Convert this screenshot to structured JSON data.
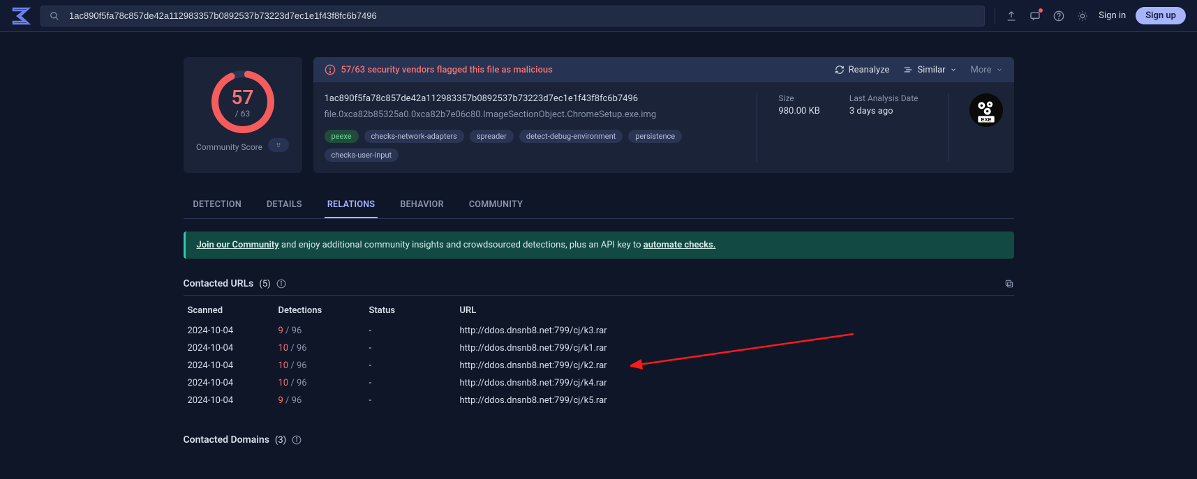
{
  "search": {
    "value": "1ac890f5fa78c857de42a112983357b0892537b73223d7ec1e1f43f8fc6b7496"
  },
  "auth": {
    "sign_in": "Sign in",
    "sign_up": "Sign up"
  },
  "score": {
    "value": "57",
    "total": "/ 63",
    "community_label": "Community Score"
  },
  "flag": {
    "message": "57/63 security vendors flagged this file as malicious"
  },
  "actions": {
    "reanalyze": "Reanalyze",
    "similar": "Similar",
    "more": "More"
  },
  "file": {
    "hash": "1ac890f5fa78c857de42a112983357b0892537b73223d7ec1e1f43f8fc6b7496",
    "name": "file.0xca82b85325a0.0xca82b7e06c80.ImageSectionObject.ChromeSetup.exe.img",
    "size_label": "Size",
    "size_value": "980.00 KB",
    "analysis_label": "Last Analysis Date",
    "analysis_value": "3 days ago",
    "type_label": "EXE"
  },
  "tags": [
    "peexe",
    "checks-network-adapters",
    "spreader",
    "detect-debug-environment",
    "persistence",
    "checks-user-input"
  ],
  "tabs": {
    "detection": "DETECTION",
    "details": "DETAILS",
    "relations": "RELATIONS",
    "behavior": "BEHAVIOR",
    "community": "COMMUNITY"
  },
  "banner": {
    "link1": "Join our Community",
    "mid": " and enjoy additional community insights and crowdsourced detections, plus an API key to ",
    "link2": "automate checks."
  },
  "sections": {
    "urls": {
      "title": "Contacted URLs",
      "count": "(5)"
    },
    "domains": {
      "title": "Contacted Domains",
      "count": "(3)"
    }
  },
  "url_table": {
    "cols": {
      "scanned": "Scanned",
      "detections": "Detections",
      "status": "Status",
      "url": "URL"
    },
    "rows": [
      {
        "scanned": "2024-10-04",
        "det": "9",
        "tot": "/ 96",
        "status": "-",
        "url": "http://ddos.dnsnb8.net:799/cj/k3.rar"
      },
      {
        "scanned": "2024-10-04",
        "det": "10",
        "tot": "/ 96",
        "status": "-",
        "url": "http://ddos.dnsnb8.net:799/cj/k1.rar"
      },
      {
        "scanned": "2024-10-04",
        "det": "10",
        "tot": "/ 96",
        "status": "-",
        "url": "http://ddos.dnsnb8.net:799/cj/k2.rar"
      },
      {
        "scanned": "2024-10-04",
        "det": "10",
        "tot": "/ 96",
        "status": "-",
        "url": "http://ddos.dnsnb8.net:799/cj/k4.rar"
      },
      {
        "scanned": "2024-10-04",
        "det": "9",
        "tot": "/ 96",
        "status": "-",
        "url": "http://ddos.dnsnb8.net:799/cj/k5.rar"
      }
    ]
  }
}
